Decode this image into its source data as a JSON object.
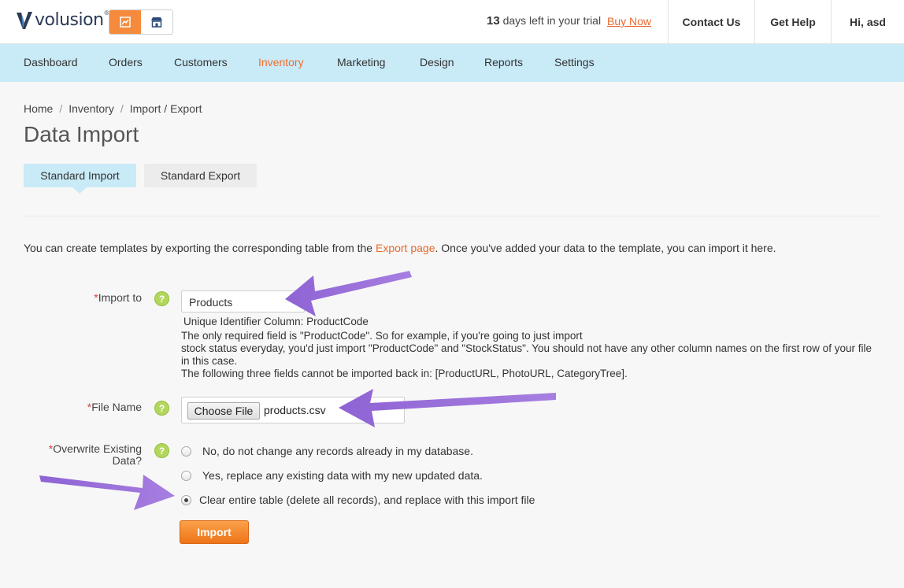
{
  "header": {
    "logo_text": "volusion",
    "logo_tm": "®",
    "trial_days": "13",
    "trial_text": "days left in your trial",
    "buy_now": "Buy Now",
    "contact_us": "Contact Us",
    "get_help": "Get Help",
    "user_greeting": "Hi, asd",
    "mode_icons": [
      "chart-icon",
      "store-icon"
    ]
  },
  "nav": {
    "items": [
      "Dashboard",
      "Orders",
      "Customers",
      "Inventory",
      "Marketing",
      "Design",
      "Reports",
      "Settings"
    ],
    "active": "Inventory"
  },
  "breadcrumb": [
    "Home",
    "Inventory",
    "Import / Export"
  ],
  "breadcrumb_sep": "/",
  "page_title": "Data Import",
  "tabs": [
    "Standard Import",
    "Standard Export"
  ],
  "intro": {
    "before": "You can create templates by exporting the corresponding table from the ",
    "link": "Export page",
    "after": ". Once you've added your data to the template, you can import it here."
  },
  "form": {
    "required_mark": "*",
    "help_glyph": "?",
    "import_to_label": "Import to",
    "import_to_value": "Products",
    "unique_id": "Unique Identifier Column: ProductCode",
    "info_lines": [
      "The only required field is \"ProductCode\". So for example, if you're going to just import",
      "stock status everyday, you'd just import \"ProductCode\" and \"StockStatus\". You should not have any other column names on the first row of your file in this case.",
      "The following three fields cannot be imported back in: [ProductURL, PhotoURL, CategoryTree]."
    ],
    "file_name_label": "File Name",
    "choose_file": "Choose File",
    "file_value": "products.csv",
    "overwrite_label_1": "Overwrite Existing",
    "overwrite_label_2": "Data?",
    "options": [
      "No, do not change any records already in my database.",
      "Yes, replace any existing data with my new updated data.",
      "Clear entire table (delete all records), and replace with this import file"
    ],
    "selected_option": "Clear entire table (delete all records), and replace with this import file",
    "import_button": "Import"
  },
  "colors": {
    "accent": "#f26d2a",
    "nav_bg": "#c9eaf7",
    "button": "#ee7418",
    "help_icon": "#b3d65c",
    "annotation_arrow": "#9b6fd6"
  }
}
